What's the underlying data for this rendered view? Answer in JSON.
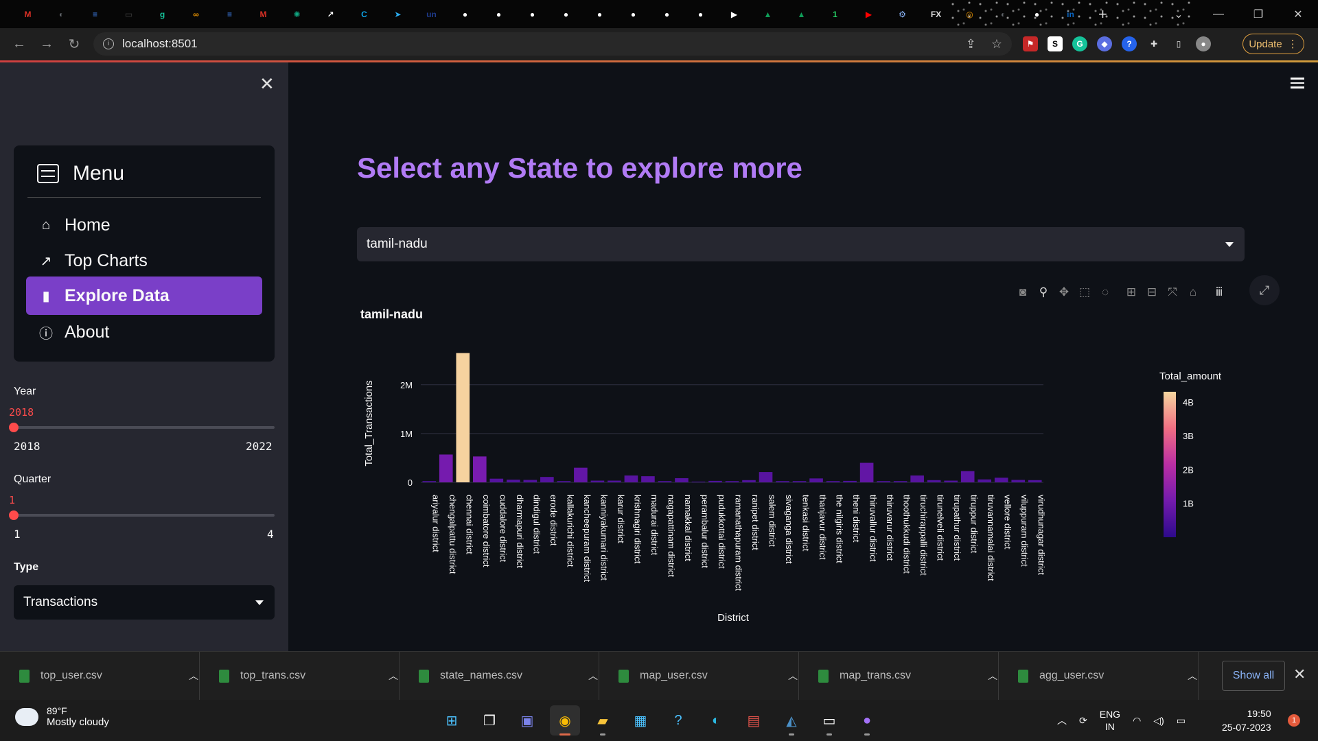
{
  "browser": {
    "url": "localhost:8501",
    "update_label": "Update",
    "tab_icons": [
      {
        "name": "gmail-icon",
        "color": "#d93025",
        "glyph": "M"
      },
      {
        "name": "globe-icon",
        "color": "#5f6368",
        "glyph": "◐"
      },
      {
        "name": "docs-icon",
        "color": "#4285f4",
        "glyph": "≡"
      },
      {
        "name": "video-icon",
        "color": "#444",
        "glyph": "▭"
      },
      {
        "name": "grammarly-icon",
        "color": "#15c39a",
        "glyph": "g"
      },
      {
        "name": "infinity-icon",
        "color": "#f29900",
        "glyph": "∞"
      },
      {
        "name": "docs-icon",
        "color": "#4285f4",
        "glyph": "≡"
      },
      {
        "name": "gmail-icon",
        "color": "#d93025",
        "glyph": "M"
      },
      {
        "name": "chatgpt-icon",
        "color": "#10a37f",
        "glyph": "✺"
      },
      {
        "name": "chart-icon",
        "color": "#fff",
        "glyph": "↗"
      },
      {
        "name": "c-icon",
        "color": "#0ea5e9",
        "glyph": "C"
      },
      {
        "name": "telegram-icon",
        "color": "#2aabee",
        "glyph": "➤"
      },
      {
        "name": "un-icon",
        "color": "#1e3a8a",
        "glyph": "un"
      },
      {
        "name": "github-icon",
        "color": "#fff",
        "glyph": "●"
      },
      {
        "name": "github-icon",
        "color": "#fff",
        "glyph": "●"
      },
      {
        "name": "github-icon",
        "color": "#fff",
        "glyph": "●"
      },
      {
        "name": "github-icon",
        "color": "#fff",
        "glyph": "●"
      },
      {
        "name": "github-icon",
        "color": "#fff",
        "glyph": "●"
      },
      {
        "name": "github-icon",
        "color": "#fff",
        "glyph": "●"
      },
      {
        "name": "github-icon",
        "color": "#fff",
        "glyph": "●"
      },
      {
        "name": "github-icon",
        "color": "#fff",
        "glyph": "●"
      },
      {
        "name": "powerautomate-icon",
        "color": "#fff",
        "glyph": "▶"
      },
      {
        "name": "drive-icon",
        "color": "#0f9d58",
        "glyph": "▲"
      },
      {
        "name": "drive-icon",
        "color": "#0f9d58",
        "glyph": "▲"
      },
      {
        "name": "whatsapp-icon",
        "color": "#25d366",
        "glyph": "1"
      },
      {
        "name": "youtube-icon",
        "color": "#ff0000",
        "glyph": "▶"
      },
      {
        "name": "settings-icon",
        "color": "#8ab4f8",
        "glyph": "⚙"
      },
      {
        "name": "fx-icon",
        "color": "#ddd",
        "glyph": "FX"
      },
      {
        "name": "tab-icon",
        "color": "#f29900",
        "glyph": "◎"
      },
      {
        "name": "globe-icon",
        "color": "#5f6368",
        "glyph": "◐"
      },
      {
        "name": "github-icon",
        "color": "#fff",
        "glyph": "●"
      },
      {
        "name": "linkedin-icon",
        "color": "#0a66c2",
        "glyph": "in"
      }
    ]
  },
  "sidebar": {
    "menu_title": "Menu",
    "items": [
      {
        "label": "Home",
        "icon": "house-icon",
        "glyph": "⌂",
        "active": false
      },
      {
        "label": "Top Charts",
        "icon": "graph-up-icon",
        "glyph": "↗",
        "active": false
      },
      {
        "label": "Explore Data",
        "icon": "bar-chart-icon",
        "glyph": "▮",
        "active": true
      },
      {
        "label": "About",
        "icon": "info-circle-icon",
        "glyph": "ⓘ",
        "active": false
      }
    ],
    "year": {
      "label": "Year",
      "value": "2018",
      "min": "2018",
      "max": "2022",
      "position": 0
    },
    "quarter": {
      "label": "Quarter",
      "value": "1",
      "min": "1",
      "max": "4",
      "position": 0
    },
    "type": {
      "label": "Type",
      "value": "Transactions"
    }
  },
  "main": {
    "title": "Select any State to explore more",
    "state_select": "tamil-nadu"
  },
  "chart_data": {
    "type": "bar",
    "title": "tamil-nadu",
    "xlabel": "District",
    "ylabel": "Total_Transactions",
    "ylim": [
      0,
      2700000
    ],
    "yticks": [
      {
        "v": 0,
        "label": "0"
      },
      {
        "v": 1000000,
        "label": "1M"
      },
      {
        "v": 2000000,
        "label": "2M"
      }
    ],
    "colorbar": {
      "title": "Total_amount",
      "range": [
        0,
        4300000000
      ],
      "ticks": [
        {
          "v": 1000000000,
          "label": "1B"
        },
        {
          "v": 2000000000,
          "label": "2B"
        },
        {
          "v": 3000000000,
          "label": "3B"
        },
        {
          "v": 4000000000,
          "label": "4B"
        }
      ]
    },
    "categories": [
      "ariyalur district",
      "chengalpattu district",
      "chennai district",
      "coimbatore district",
      "cuddalore district",
      "dharmapuri district",
      "dindigul district",
      "erode district",
      "kallakurichi district",
      "kancheepuram district",
      "kanniyakumari district",
      "karur district",
      "krishnagiri district",
      "madurai district",
      "nagapattinam district",
      "namakkal district",
      "perambalur district",
      "pudukkottai district",
      "ramanathapuram district",
      "ranipet district",
      "salem district",
      "sivaganga district",
      "tenkasi district",
      "thanjavur district",
      "the nilgiris district",
      "theni district",
      "thiruvallur district",
      "thiruvarur district",
      "thoothukkudi district",
      "tiruchirappalli district",
      "tirunelveli district",
      "tirupathur district",
      "tiruppur district",
      "tiruvannamalai district",
      "vellore district",
      "viluppuram district",
      "virudhunagar district"
    ],
    "values": [
      25000,
      570000,
      2650000,
      530000,
      75000,
      55000,
      50000,
      110000,
      25000,
      300000,
      35000,
      35000,
      140000,
      125000,
      25000,
      85000,
      15000,
      30000,
      25000,
      45000,
      210000,
      25000,
      25000,
      80000,
      25000,
      30000,
      400000,
      25000,
      25000,
      140000,
      45000,
      35000,
      230000,
      60000,
      95000,
      50000,
      45000
    ],
    "amounts": [
      500000000,
      1100000000,
      4250000000,
      1150000000,
      600000000,
      550000000,
      550000000,
      600000000,
      500000000,
      800000000,
      550000000,
      550000000,
      650000000,
      650000000,
      500000000,
      600000000,
      450000000,
      500000000,
      500000000,
      550000000,
      650000000,
      500000000,
      500000000,
      600000000,
      500000000,
      500000000,
      800000000,
      500000000,
      500000000,
      650000000,
      550000000,
      550000000,
      700000000,
      550000000,
      600000000,
      550000000,
      550000000
    ]
  },
  "downloads": [
    {
      "name": "top_user.csv"
    },
    {
      "name": "top_trans.csv"
    },
    {
      "name": "state_names.csv"
    },
    {
      "name": "map_user.csv"
    },
    {
      "name": "map_trans.csv"
    },
    {
      "name": "agg_user.csv"
    }
  ],
  "downloads_show_all": "Show all",
  "taskbar": {
    "temp": "89°F",
    "weather": "Mostly cloudy",
    "lang1": "ENG",
    "lang2": "IN",
    "time": "19:50",
    "date": "25-07-2023",
    "notifications": "1"
  }
}
